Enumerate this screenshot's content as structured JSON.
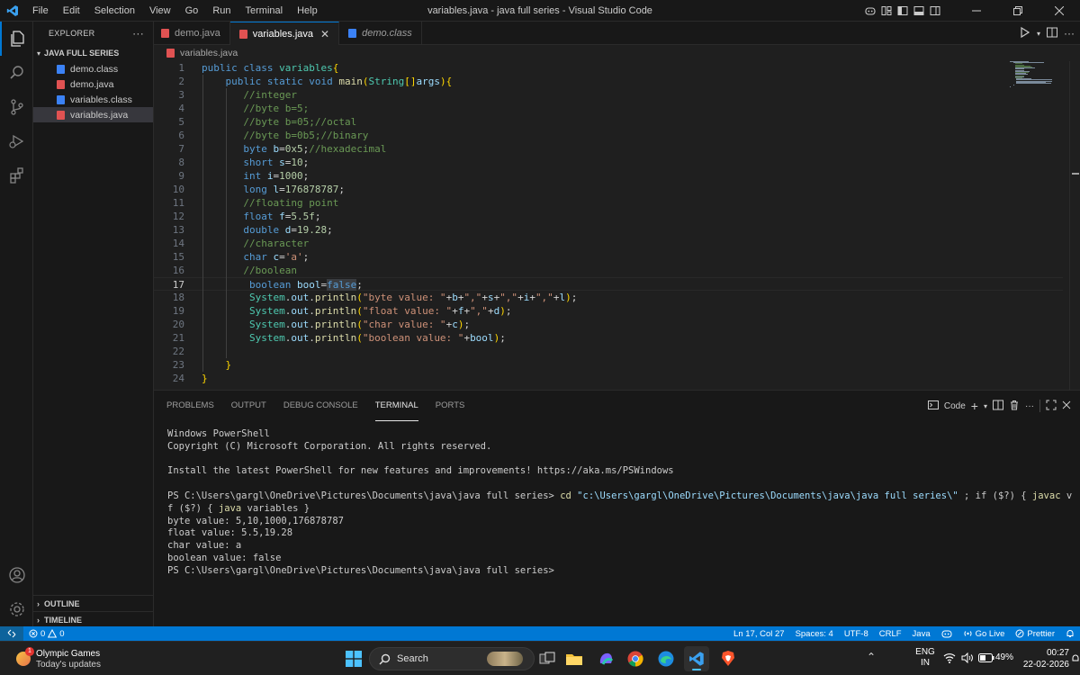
{
  "window": {
    "title": "variables.java - java full series - Visual Studio Code",
    "menu": [
      "File",
      "Edit",
      "Selection",
      "View",
      "Go",
      "Run",
      "Terminal",
      "Help"
    ]
  },
  "sidebar": {
    "header": "EXPLORER",
    "more": "···",
    "folder": "JAVA FULL SERIES",
    "files": [
      {
        "name": "demo.class",
        "kind": "class"
      },
      {
        "name": "demo.java",
        "kind": "java"
      },
      {
        "name": "variables.class",
        "kind": "class"
      },
      {
        "name": "variables.java",
        "kind": "java",
        "selected": true
      }
    ],
    "outline": "OUTLINE",
    "timeline": "TIMELINE"
  },
  "tabs": [
    {
      "label": "demo.java",
      "active": false,
      "italic": false
    },
    {
      "label": "variables.java",
      "active": true,
      "italic": false
    },
    {
      "label": "demo.class",
      "active": false,
      "italic": true
    }
  ],
  "breadcrumb": "variables.java",
  "editor": {
    "current_line": 17,
    "lines": [
      "public class variables{",
      "    public static void main(String[]args){",
      "       //integer",
      "       //byte b=5;",
      "       //byte b=05;//octal",
      "       //byte b=0b5;//binary",
      "       byte b=0x5;//hexadecimal",
      "       short s=10;",
      "       int i=1000;",
      "       long l=176878787;",
      "       //floating point",
      "       float f=5.5f;",
      "       double d=19.28;",
      "       //character",
      "       char c='a';",
      "       //boolean",
      "        boolean bool=false;",
      "        System.out.println(\"byte value: \"+b+\",\"+s+\",\"+i+\",\"+l);",
      "        System.out.println(\"float value: \"+f+\",\"+d);",
      "        System.out.println(\"char value: \"+c);",
      "        System.out.println(\"boolean value: \"+bool);",
      "",
      "    }",
      "}"
    ]
  },
  "panel": {
    "tabs": [
      "PROBLEMS",
      "OUTPUT",
      "DEBUG CONSOLE",
      "TERMINAL",
      "PORTS"
    ],
    "active_tab": "TERMINAL",
    "terminal_name": "Code",
    "terminal_lines": [
      "Windows PowerShell",
      "Copyright (C) Microsoft Corporation. All rights reserved.",
      "",
      "Install the latest PowerShell for new features and improvements! https://aka.ms/PSWindows",
      "",
      "PS C:\\Users\\gargl\\OneDrive\\Pictures\\Documents\\java\\java full series> cd \"c:\\Users\\gargl\\OneDrive\\Pictures\\Documents\\java\\java full series\\\" ; if ($?) { javac variables.java } ; i",
      "f ($?) { java variables }",
      "byte value: 5,10,1000,176878787",
      "float value: 5.5,19.28",
      "char value: a",
      "boolean value: false",
      "PS C:\\Users\\gargl\\OneDrive\\Pictures\\Documents\\java\\java full series>"
    ]
  },
  "statusbar": {
    "errors": "0",
    "warnings": "0",
    "position": "Ln 17, Col 27",
    "spaces": "Spaces: 4",
    "encoding": "UTF-8",
    "eol": "CRLF",
    "language": "Java",
    "golive": "Go Live",
    "prettier": "Prettier"
  },
  "taskbar": {
    "news_badge": "1",
    "news_title": "Olympic Games",
    "news_sub": "Today's updates",
    "search_placeholder": "Search",
    "lang_top": "ENG",
    "lang_bottom": "IN",
    "battery": "49%",
    "time": "00:27",
    "date": "22-02-2026"
  },
  "colors": {
    "accent": "#0078d4",
    "keyword": "#569cd6",
    "control": "#c586c0",
    "type": "#4ec9b0",
    "function": "#dcdcaa",
    "string": "#ce9178",
    "number": "#b5cea8",
    "comment": "#6a9955",
    "variable": "#9cdcfe",
    "java_file": "#e05252",
    "class_file": "#3b82f6"
  }
}
